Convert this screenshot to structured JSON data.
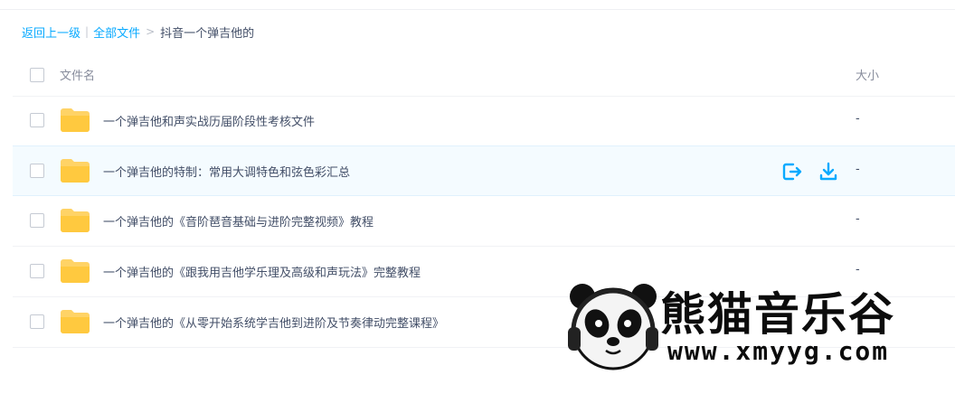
{
  "breadcrumb": {
    "back": "返回上一级",
    "separator": "|",
    "root": "全部文件",
    "arrow": ">",
    "current": "抖音一个弹吉他的"
  },
  "table": {
    "columns": {
      "name": "文件名",
      "size": "大小"
    },
    "rows": [
      {
        "name": "一个弹吉他和声实战历届阶段性考核文件",
        "size": "-",
        "icon": "folder-icon"
      },
      {
        "name": "一个弹吉他的特制：常用大调特色和弦色彩汇总",
        "size": "-",
        "icon": "folder-icon",
        "hovered": true,
        "actions": [
          "share-icon",
          "download-icon"
        ]
      },
      {
        "name": "一个弹吉他的《音阶琶音基础与进阶完整视频》教程",
        "size": "-",
        "icon": "folder-icon"
      },
      {
        "name": "一个弹吉他的《跟我用吉他学乐理及高级和声玩法》完整教程",
        "size": "-",
        "icon": "folder-icon"
      },
      {
        "name": "一个弹吉他的《从零开始系统学吉他到进阶及节奏律动完整课程》",
        "size": "",
        "icon": "folder-icon"
      }
    ]
  },
  "watermark": {
    "title": "熊猫音乐谷",
    "url": "www.xmyyg.com"
  },
  "colors": {
    "link": "#09aaff",
    "folder": "#ffd366",
    "hover_row": "#f4fbff"
  }
}
